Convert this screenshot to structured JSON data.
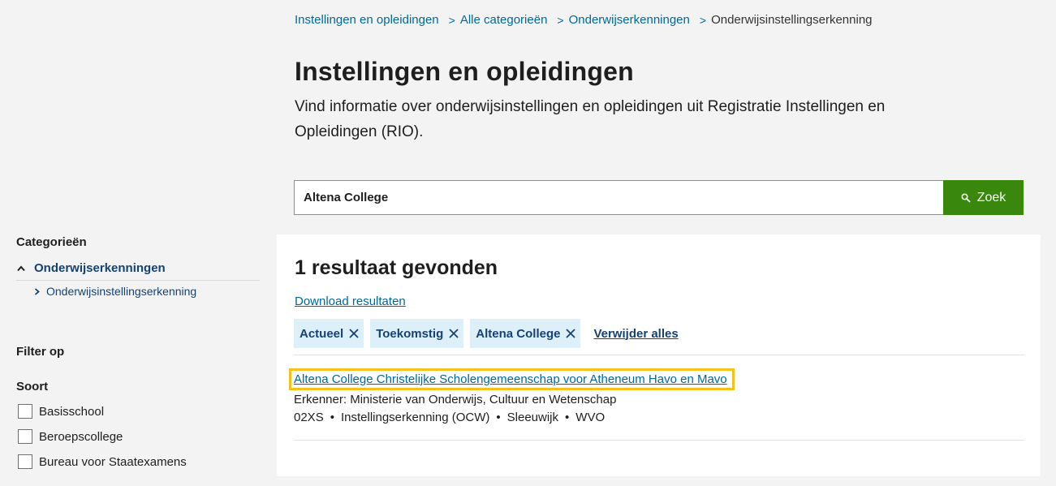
{
  "breadcrumb": {
    "items": [
      "Instellingen en opleidingen",
      "Alle categorieën",
      "Onderwijserkenningen"
    ],
    "current": "Onderwijsinstellingserkenning"
  },
  "header": {
    "title": "Instellingen en opleidingen",
    "intro": "Vind informatie over onderwijsinstellingen en opleidingen uit Registratie Instellingen en Opleidingen (RIO)."
  },
  "search": {
    "value": "Altena College",
    "button_label": "Zoek",
    "button_icon": "search-icon"
  },
  "sidebar": {
    "categories_heading": "Categorieën",
    "main_category": "Onderwijserkenningen",
    "sub_category": "Onderwijsinstellingserkenning",
    "filter_heading": "Filter op",
    "soort_heading": "Soort",
    "soort_options": [
      "Basisschool",
      "Beroepscollege",
      "Bureau voor Staatexamens"
    ]
  },
  "results": {
    "count_text": "1 resultaat gevonden",
    "download_label": "Download resultaten",
    "chips": [
      "Actueel",
      "Toekomstig",
      "Altena College"
    ],
    "remove_all_label": "Verwijder alles",
    "items": [
      {
        "title": "Altena College Christelijke Scholengemeenschap voor Atheneum Havo en Mavo",
        "meta": "Erkenner: Ministerie van Onderwijs, Cultuur en Wetenschap",
        "tags": [
          "02XS",
          "Instellingserkenning (OCW)",
          "Sleeuwijk",
          "WVO"
        ]
      }
    ]
  },
  "colors": {
    "link": "#01689b",
    "search_button": "#39870c",
    "chip_bg": "#ddeff8",
    "highlight": "#f5c21b"
  }
}
